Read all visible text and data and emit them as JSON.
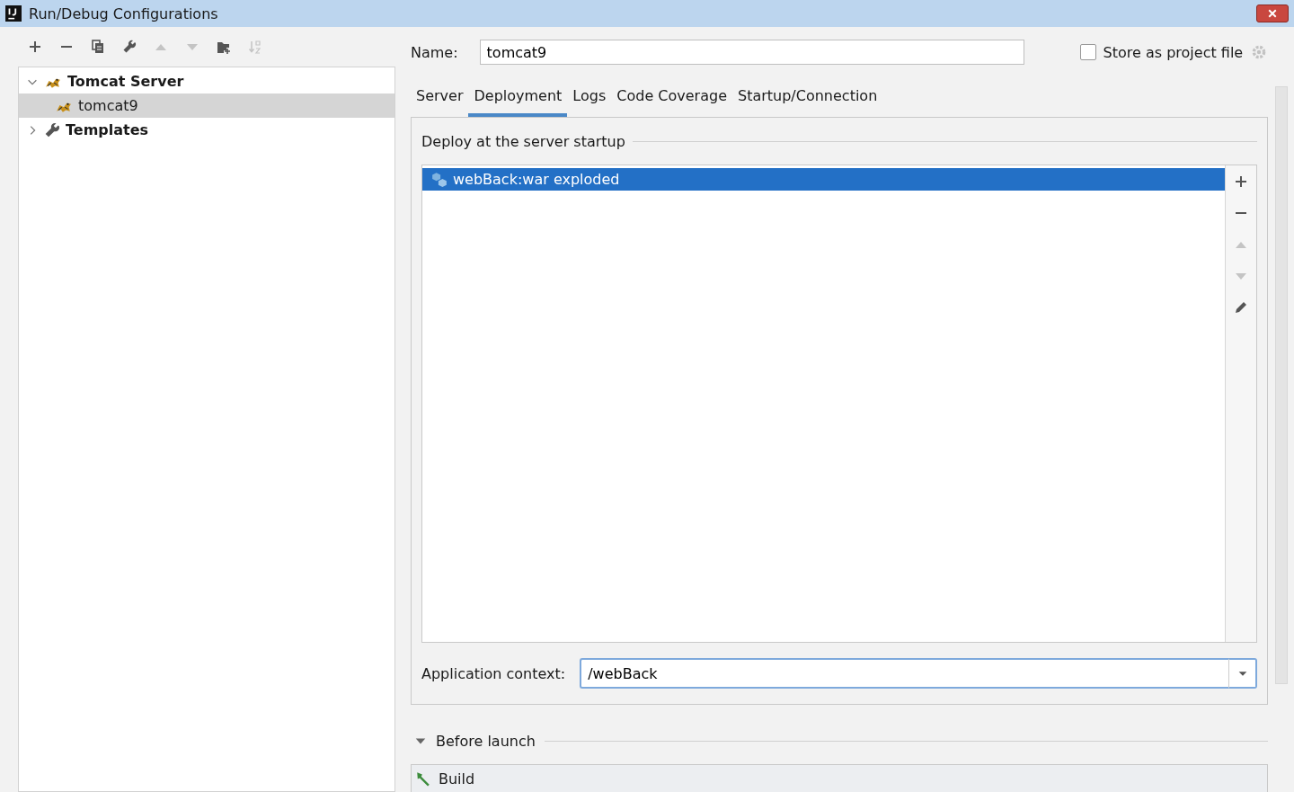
{
  "window": {
    "title": "Run/Debug Configurations"
  },
  "toolbar": [
    {
      "kind": "add",
      "disabled": false
    },
    {
      "kind": "remove",
      "disabled": false
    },
    {
      "kind": "copy",
      "disabled": false
    },
    {
      "kind": "wrench",
      "disabled": false
    },
    {
      "kind": "up",
      "disabled": true
    },
    {
      "kind": "down",
      "disabled": true
    },
    {
      "kind": "folder",
      "disabled": false
    },
    {
      "kind": "sort",
      "disabled": true
    }
  ],
  "tree": [
    {
      "label": "Tomcat Server",
      "expanded": true,
      "selected": false,
      "children": [
        {
          "label": "tomcat9",
          "selected": true
        }
      ]
    },
    {
      "label": "Templates",
      "expanded": false,
      "selected": false
    }
  ],
  "name_field": {
    "label": "Name:",
    "value": "tomcat9"
  },
  "store_option": {
    "label": "Store as project file",
    "checked": false
  },
  "tabs": [
    {
      "label": "Server",
      "selected": false
    },
    {
      "label": "Deployment",
      "selected": true
    },
    {
      "label": "Logs",
      "selected": false
    },
    {
      "label": "Code Coverage",
      "selected": false
    },
    {
      "label": "Startup/Connection",
      "selected": false
    }
  ],
  "deploy_section": {
    "title": "Deploy at the server startup",
    "items": [
      {
        "label": "webBack:war exploded",
        "selected": true
      }
    ],
    "side_buttons": [
      {
        "kind": "add",
        "disabled": false
      },
      {
        "kind": "remove",
        "disabled": false
      },
      {
        "kind": "up",
        "disabled": true
      },
      {
        "kind": "down",
        "disabled": true
      },
      {
        "kind": "edit",
        "disabled": false
      }
    ]
  },
  "context_field": {
    "label": "Application context:",
    "value": "/webBack"
  },
  "before_launch": {
    "title": "Before launch",
    "expanded": true,
    "tasks": [
      {
        "label": "Build"
      }
    ]
  }
}
